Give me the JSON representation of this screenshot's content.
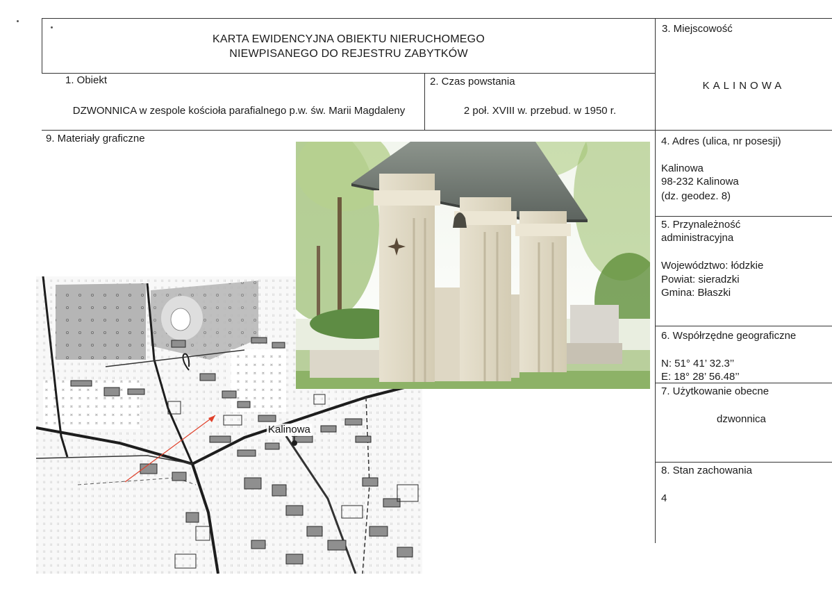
{
  "header": {
    "title_line1": "KARTA EWIDENCYJNA OBIEKTU NIERUCHOMEGO",
    "title_line2": "NIEWPISANEGO DO REJESTRU ZABYTKÓW"
  },
  "obiekt": {
    "label": "1.  Obiekt",
    "value": "DZWONNICA  w zespole kościoła parafialnego p.w. św. Marii Magdaleny"
  },
  "czas": {
    "label": "2. Czas powstania",
    "value": "2 poł. XVIII w. przebud. w 1950 r."
  },
  "miejscowosc": {
    "label": "3. Miejscowość",
    "value": "KALINOWA"
  },
  "adres": {
    "label": "4. Adres (ulica, nr posesji)",
    "line1": "Kalinowa",
    "line2": "98-232  Kalinowa",
    "line3": " (dz. geodez. 8)"
  },
  "przynaleznosc": {
    "label_line1": "5. Przynależność",
    "label_line2": "administracyjna",
    "wojewodztwo": "Województwo: łódzkie",
    "powiat": "Powiat: sieradzki",
    "gmina": "Gmina: Błaszki"
  },
  "wspolrzedne": {
    "label": "6. Współrzędne geograficzne",
    "n": "N: 51° 41’ 32.3’’",
    "e": "E: 18° 28’ 56.48’’"
  },
  "uzytkowanie": {
    "label": "7. Użytkowanie obecne",
    "value": "dzwonnica"
  },
  "stan": {
    "label": "8. Stan zachowania",
    "value": "4"
  },
  "materialy": {
    "label": "9. Materiały graficzne",
    "map_label": "Kalinowa"
  },
  "colors": {
    "rule": "#333333",
    "map_arrow": "#e0402a",
    "map_gray": "#a9a9a9"
  }
}
